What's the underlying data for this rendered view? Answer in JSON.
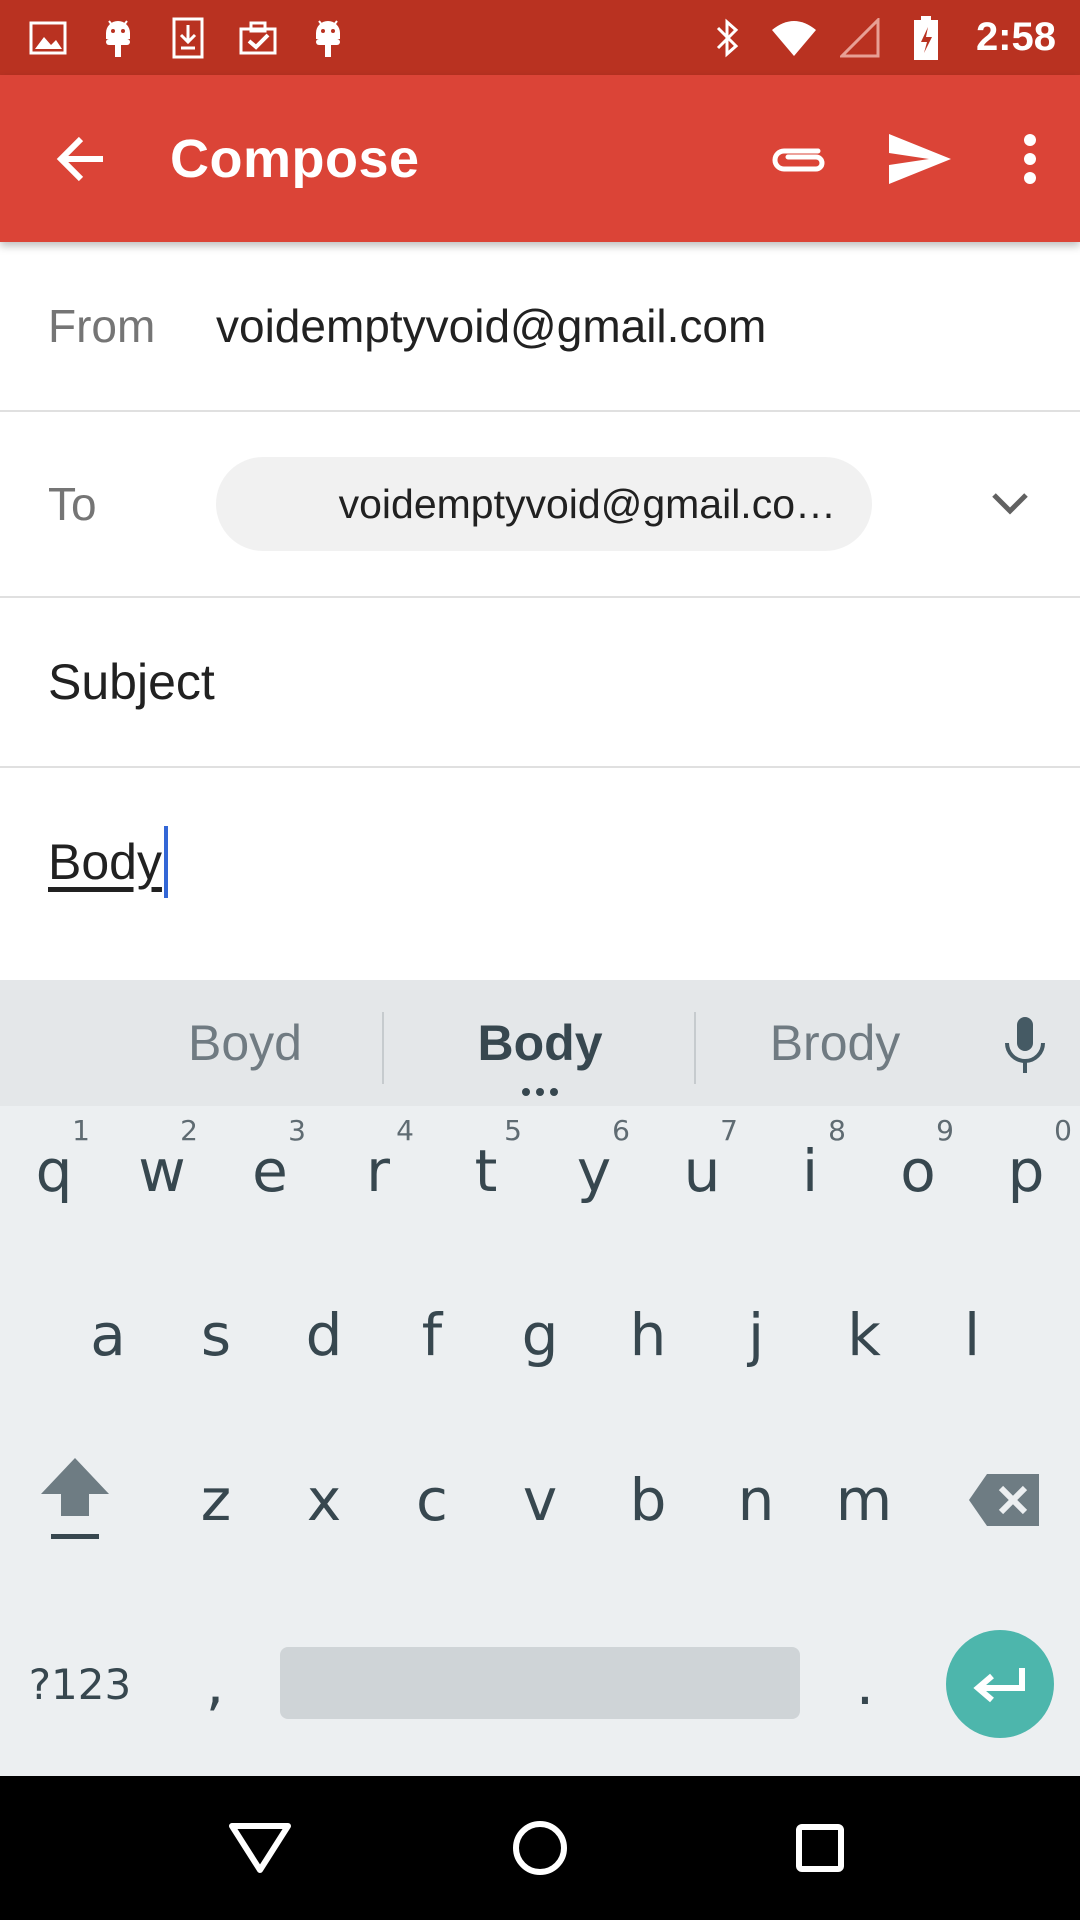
{
  "status_bar": {
    "time": "2:58",
    "icons": [
      "image-icon",
      "android-icon",
      "download-icon",
      "clipboard-check-icon",
      "android-icon",
      "bluetooth-icon",
      "wifi-icon",
      "signal-icon",
      "battery-icon"
    ]
  },
  "toolbar": {
    "title": "Compose",
    "icons": [
      "arrow-back-icon",
      "attachment-icon",
      "send-icon",
      "more-vert-icon"
    ]
  },
  "compose": {
    "from_label": "From",
    "from_value": "voidemptyvoid@gmail.com",
    "to_label": "To",
    "to_chip": "voidemptyvoid@gmail.co…",
    "subject_placeholder": "Subject",
    "body_value": "Body"
  },
  "keyboard": {
    "suggestions": [
      "Boyd",
      "Body",
      "Brody"
    ],
    "row1": [
      {
        "key": "q",
        "hint": "1"
      },
      {
        "key": "w",
        "hint": "2"
      },
      {
        "key": "e",
        "hint": "3"
      },
      {
        "key": "r",
        "hint": "4"
      },
      {
        "key": "t",
        "hint": "5"
      },
      {
        "key": "y",
        "hint": "6"
      },
      {
        "key": "u",
        "hint": "7"
      },
      {
        "key": "i",
        "hint": "8"
      },
      {
        "key": "o",
        "hint": "9"
      },
      {
        "key": "p",
        "hint": "0"
      }
    ],
    "row2": [
      "a",
      "s",
      "d",
      "f",
      "g",
      "h",
      "j",
      "k",
      "l"
    ],
    "row3": [
      "z",
      "x",
      "c",
      "v",
      "b",
      "n",
      "m"
    ],
    "symbols_key": "?123",
    "comma_key": ",",
    "period_key": ".",
    "accent_color": "#4db6ac"
  },
  "colors": {
    "status_bar": "#b93221",
    "toolbar": "#db4437",
    "cursor": "#3367d6"
  }
}
